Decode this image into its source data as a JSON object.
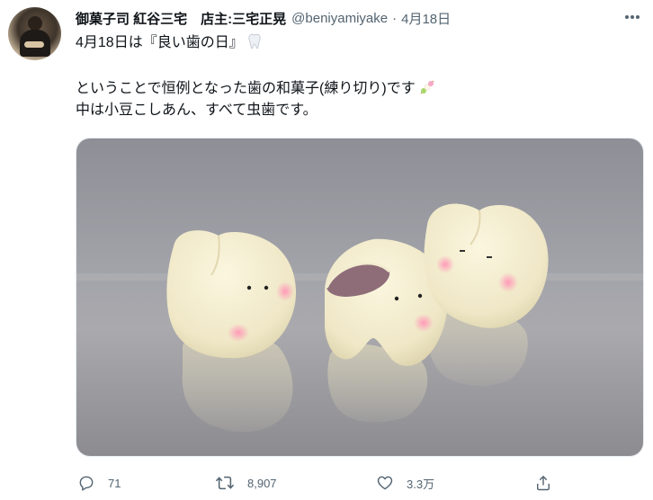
{
  "tweet": {
    "author_name": "御菓子司 紅谷三宅　店主:三宅正晃",
    "handle": "@beniyamiyake",
    "separator": "·",
    "date": "4月18日",
    "lines": [
      "4月18日は『良い歯の日』",
      "ということで恒例となった歯の和菓子(練り切り)です",
      "中は小豆こしあん、すべて虫歯です。"
    ],
    "icons": {
      "line1_emoji": "tooth-emoji-icon",
      "line2_emoji": "dango-emoji-icon"
    }
  },
  "actions": {
    "reply_count": "71",
    "retweet_count": "8,907",
    "like_count": "3.3万"
  },
  "colors": {
    "text": "#0f1419",
    "secondary": "#536471",
    "border": "#e6ecf0"
  }
}
